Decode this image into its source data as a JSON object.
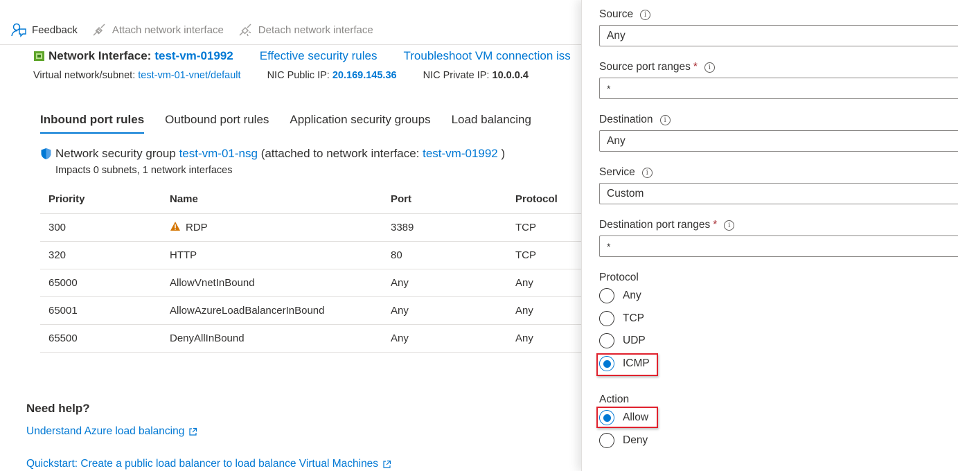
{
  "toolbar": {
    "feedback": "Feedback",
    "attach": "Attach network interface",
    "detach": "Detach network interface"
  },
  "nic": {
    "label": "Network Interface:",
    "name": "test-vm-01992",
    "effective_rules": "Effective security rules",
    "troubleshoot": "Troubleshoot VM connection iss"
  },
  "meta": {
    "vnet_label": "Virtual network/subnet:",
    "vnet_value": "test-vm-01-vnet/default",
    "public_ip_label": "NIC Public IP:",
    "public_ip_value": "20.169.145.36",
    "private_ip_label": "NIC Private IP:",
    "private_ip_value": "10.0.0.4"
  },
  "tabs": [
    "Inbound port rules",
    "Outbound port rules",
    "Application security groups",
    "Load balancing"
  ],
  "nsg": {
    "prefix": "Network security group",
    "name": "test-vm-01-nsg",
    "middle": "(attached to network interface:",
    "nic": "test-vm-01992",
    "suffix": ")",
    "impacts": "Impacts 0 subnets, 1 network interfaces"
  },
  "table": {
    "headers": [
      "Priority",
      "Name",
      "Port",
      "Protocol"
    ],
    "rows": [
      {
        "priority": "300",
        "name": "RDP",
        "port": "3389",
        "protocol": "TCP",
        "warning": true
      },
      {
        "priority": "320",
        "name": "HTTP",
        "port": "80",
        "protocol": "TCP",
        "warning": false
      },
      {
        "priority": "65000",
        "name": "AllowVnetInBound",
        "port": "Any",
        "protocol": "Any",
        "warning": false
      },
      {
        "priority": "65001",
        "name": "AllowAzureLoadBalancerInBound",
        "port": "Any",
        "protocol": "Any",
        "warning": false
      },
      {
        "priority": "65500",
        "name": "DenyAllInBound",
        "port": "Any",
        "protocol": "Any",
        "warning": false
      }
    ]
  },
  "help": {
    "heading": "Need help?",
    "link1": "Understand Azure load balancing",
    "link2": "Quickstart: Create a public load balancer to load balance Virtual Machines"
  },
  "panel": {
    "source_label": "Source",
    "source_value": "Any",
    "source_ports_label": "Source port ranges",
    "source_ports_value": "*",
    "destination_label": "Destination",
    "destination_value": "Any",
    "service_label": "Service",
    "service_value": "Custom",
    "dest_ports_label": "Destination port ranges",
    "dest_ports_value": "*",
    "required_mark": "*",
    "info_glyph": "i",
    "protocol_label": "Protocol",
    "protocol_options": [
      "Any",
      "TCP",
      "UDP",
      "ICMP"
    ],
    "protocol_selected": "ICMP",
    "action_label": "Action",
    "action_options": [
      "Allow",
      "Deny"
    ],
    "action_selected": "Allow"
  },
  "colors": {
    "link": "#0078d4",
    "highlight": "#e0222e",
    "warning": "#d47500",
    "required": "#a4262c"
  }
}
